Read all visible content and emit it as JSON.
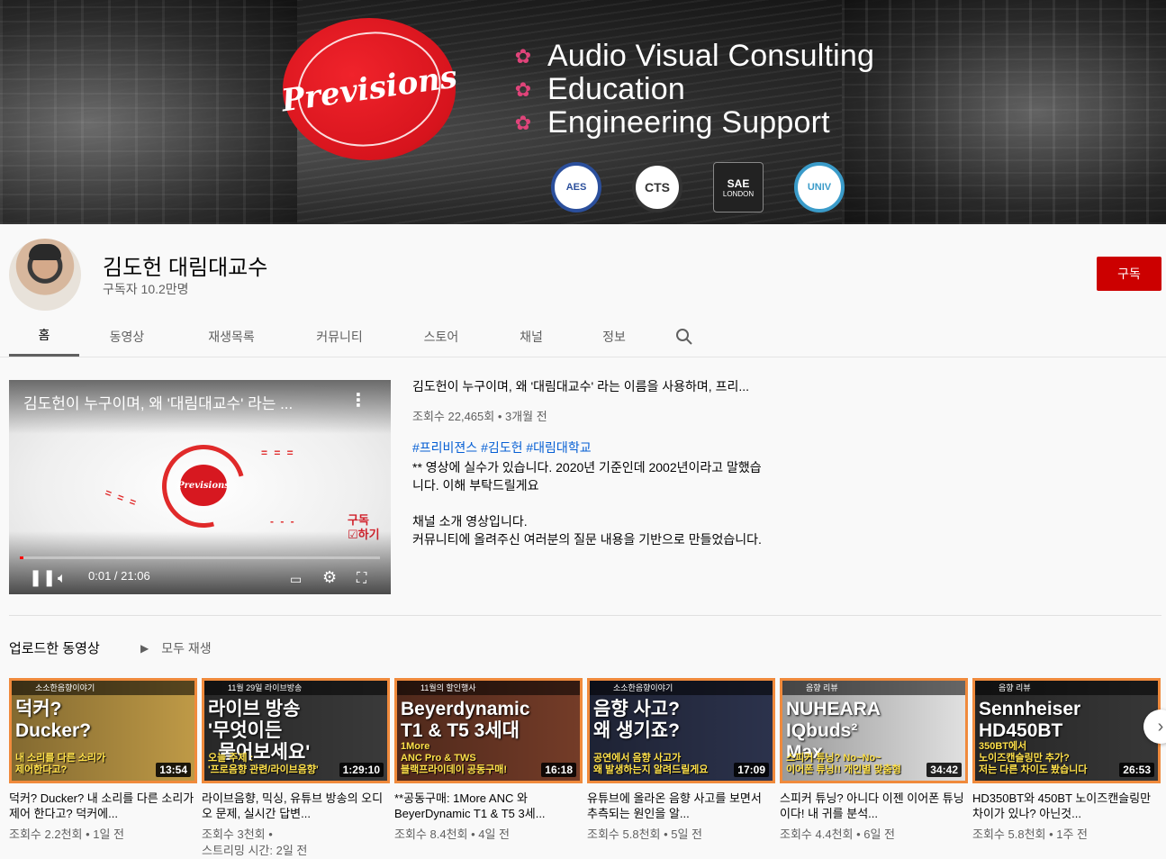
{
  "banner": {
    "logo": "Previsions",
    "services": [
      "Audio Visual Consulting",
      "Education",
      "Engineering Support"
    ],
    "badges": [
      "AES",
      "CTS",
      "SAE",
      "UNIV"
    ],
    "sae_sub": "LONDON"
  },
  "channel": {
    "name": "김도헌 대림대교수",
    "subscribers": "구독자 10.2만명",
    "subscribe_label": "구독"
  },
  "tabs": [
    "홈",
    "동영상",
    "재생목록",
    "커뮤니티",
    "스토어",
    "채널",
    "정보"
  ],
  "featured": {
    "overlay_title": "김도헌이 누구이며, 왜 '대림대교수' 라는 ...",
    "logo": "Previsions",
    "subscribe_overlay": [
      "구독",
      "☑하기"
    ],
    "time": "0:01 / 21:06",
    "progress": 0.01,
    "title": "김도헌이 누구이며, 왜 '대림대교수' 라는 이름을 사용하며, 프리...",
    "meta": "조회수 22,465회 • 3개월 전",
    "tags": "#프리비젼스 #김도헌 #대림대학교",
    "body": "** 영상에 실수가 있습니다. 2020년 기준인데 2002년이라고 말했습니다. 이해 부탁드릴게요\n\n채널 소개 영상입니다.\n커뮤니티에 올려주신 여러분의 질문 내용을 기반으로 만들었습니다."
  },
  "shelf": {
    "title": "업로드한 동영상",
    "play_all": "모두 재생"
  },
  "videos": [
    {
      "top": "소소한음향이야기",
      "big": "덕커?\nDucker?",
      "small": "내 소리를 다른 소리가\n제어한다고?",
      "duration": "13:54",
      "bg": "#c9a24a",
      "title": "덕커? Ducker? 내 소리를 다른 소리가 제어 한다고? 덕커에...",
      "meta": "조회수 2.2천회 • 1일 전"
    },
    {
      "top": "11월 29일 라이브방송",
      "big": "라이브 방송\n'무엇이든\n  물어보세요'",
      "small": "오늘 주제 :\n'프로음향 관련/라이브음향'",
      "duration": "1:29:10",
      "bg": "#3d3d3d",
      "title": "라이브음향, 믹싱, 유튜브 방송의 오디오 문제, 실시간 답변...",
      "meta": "조회수 3천회 •",
      "meta2": "스트리밍 시간: 2일 전"
    },
    {
      "top": "11월의 할인행사",
      "big": "Beyerdynamic\nT1 & T5 3세대",
      "small": "1More\nANC Pro & TWS\n블랙프라이데이 공동구매!",
      "duration": "16:18",
      "bg": "#7a3f2a",
      "title": "**공동구매: 1More ANC 와 BeyerDynamic T1 & T5 3세...",
      "meta": "조회수 8.4천회 • 4일 전"
    },
    {
      "top": "소소한음향이야기",
      "big": "음향 사고?\n왜 생기죠?",
      "small": "공연에서 음향 사고가\n왜 발생하는지 알려드릴게요",
      "duration": "17:09",
      "bg": "#2e3550",
      "title": "유튜브에 올라온 음향 사고를 보면서 추측되는 원인을 알...",
      "meta": "조회수 5.8천회 • 5일 전"
    },
    {
      "top": "음향 리뷰",
      "big": "NUHEARA\nIQbuds²\nMax",
      "small": "스피커 튜닝? No~No~\n이어폰 튜닝!! 개인별 맞춤형",
      "duration": "34:42",
      "bg": "#ececec",
      "title": "스피커 튜닝? 아니다 이젠 이어폰 튜닝이다! 내 귀를 분석...",
      "meta": "조회수 4.4천회 • 6일 전"
    },
    {
      "top": "음향 리뷰",
      "big": "Sennheiser\nHD450BT",
      "small": "350BT에서\n노이즈캔슬링만 추가?\n저는 다른 차이도 봤습니다",
      "duration": "26:53",
      "bg": "#3a3a3a",
      "title": "HD350BT와 450BT 노이즈캔슬링만 차이가 있나? 아닌것...",
      "meta": "조회수 5.8천회 • 1주 전"
    }
  ],
  "colors": {
    "accent": "#cc0000",
    "link": "#065fd4",
    "thumb_border": "#f08a3c"
  }
}
